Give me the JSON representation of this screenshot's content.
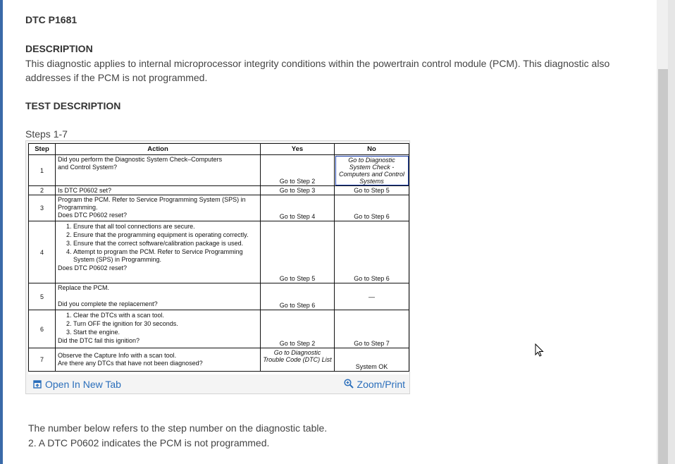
{
  "header": {
    "dtc_title": "DTC P1681",
    "description_heading": "DESCRIPTION",
    "description_text": " This diagnostic applies to internal microprocessor integrity conditions within the powertrain control module (PCM). This diagnostic also addresses if the PCM is not programmed.",
    "test_description_heading": "TEST DESCRIPTION",
    "steps_label": "Steps 1-7"
  },
  "table": {
    "headers": {
      "step": "Step",
      "action": "Action",
      "yes": "Yes",
      "no": "No"
    },
    "rows": [
      {
        "step": "1",
        "action": [
          "Did you perform the Diagnostic System Check–Computers",
          "and Control System?"
        ],
        "yes": "Go to Step 2",
        "no": "Go to Diagnostic System Check - Computers and Control Systems"
      },
      {
        "step": "2",
        "action": [
          "Is DTC P0602 set?"
        ],
        "yes": "Go to Step 3",
        "no": "Go to Step 5"
      },
      {
        "step": "3",
        "action": [
          "Program the PCM. Refer to Service Programming System (SPS) in Programming.",
          "Does DTC P0602 reset?"
        ],
        "yes": "Go to Step 4",
        "no": "Go to Step 6"
      },
      {
        "step": "4",
        "list": [
          "Ensure that all tool connections are secure.",
          "Ensure that the programming equipment is operating correctly.",
          "Ensure that the correct software/calibration package is used.",
          "Attempt to program the PCM. Refer to Service Programming System (SPS) in Programming."
        ],
        "question": "Does DTC P0602 reset?",
        "yes": "Go to Step 5",
        "no": "Go to Step 6"
      },
      {
        "step": "5",
        "action": [
          "Replace the PCM.",
          "Did you complete the replacement?"
        ],
        "yes": "Go to Step 6",
        "no": "—"
      },
      {
        "step": "6",
        "list": [
          "Clear the DTCs with a scan tool.",
          "Turn OFF the ignition for 30 seconds.",
          "Start the engine."
        ],
        "question": "Did the DTC fail this ignition?",
        "yes": "Go to Step 2",
        "no": "Go to Step 7"
      },
      {
        "step": "7",
        "action": [
          "Observe the Capture Info with a scan tool.",
          "Are there any DTCs that have not been diagnosed?"
        ],
        "yes": "Go to Diagnostic Trouble Code (DTC) List",
        "no": "System OK"
      }
    ]
  },
  "figure_footer": {
    "open_tab_label": "Open In New Tab",
    "zoom_label": "Zoom/Print",
    "open_tab_icon": "open-new-tab-icon",
    "zoom_icon": "magnifier-icon",
    "link_color": "#2a6ebb"
  },
  "notes": {
    "intro": "The number below refers to the step number on the diagnostic table.",
    "item_2": "2. A DTC P0602 indicates the PCM is not programmed."
  }
}
